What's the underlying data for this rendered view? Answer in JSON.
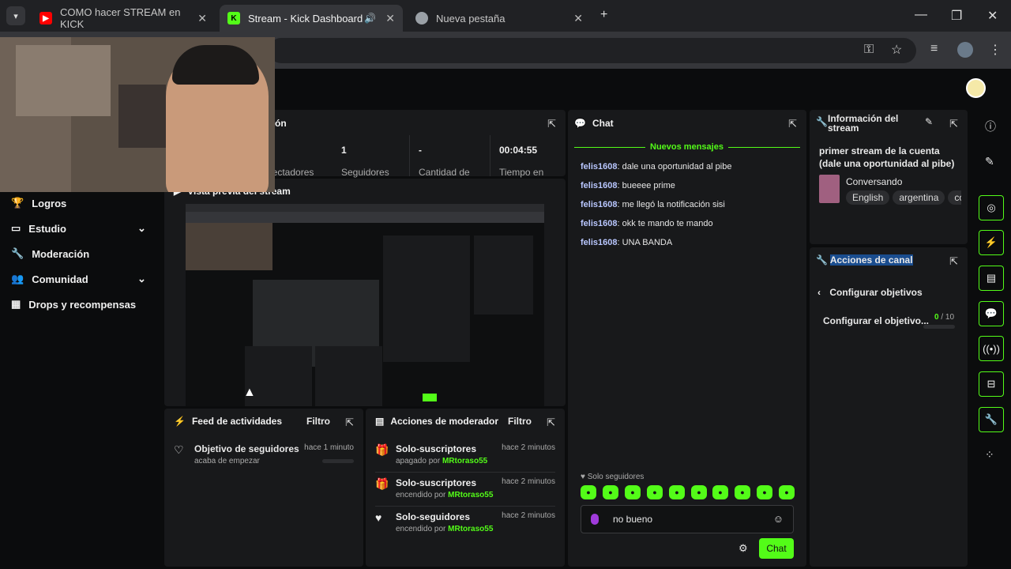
{
  "browser": {
    "tabs": [
      {
        "title": "COMO hacer STREAM en KICK"
      },
      {
        "title": "Stream - Kick Dashboard"
      },
      {
        "title": "Nueva pestaña"
      }
    ]
  },
  "sidebar": {
    "items": [
      {
        "label": "Logros",
        "icon": "trophy-icon"
      },
      {
        "label": "Estudio",
        "icon": "studio-icon"
      },
      {
        "label": "Moderación",
        "icon": "wrench-icon"
      },
      {
        "label": "Comunidad",
        "icon": "community-icon"
      },
      {
        "label": "Drops y recompensas",
        "icon": "drops-icon"
      }
    ]
  },
  "session": {
    "title_partial": "sión",
    "stats": [
      {
        "value": "",
        "label": "pectadores"
      },
      {
        "value": "1",
        "label": "Seguidores"
      },
      {
        "value": "-",
        "label": "Cantidad de"
      },
      {
        "value": "00:04:55",
        "label": "Tiempo en"
      }
    ]
  },
  "preview": {
    "title": "Vista previa del stream"
  },
  "activity": {
    "title": "Feed de actividades",
    "filter": "Filtro",
    "item": {
      "title": "Objetivo de seguidores",
      "subtitle": "acaba de empezar",
      "time": "hace 1 minuto"
    }
  },
  "mod_actions": {
    "title": "Acciones de moderador",
    "filter": "Filtro",
    "rows": [
      {
        "title": "Solo-suscriptores",
        "action": "apagado por",
        "user": "MRtoraso55",
        "time": "hace 2 minutos"
      },
      {
        "title": "Solo-suscriptores",
        "action": "encendido por",
        "user": "MRtoraso55",
        "time": "hace 2 minutos"
      },
      {
        "title": "Solo-seguidores",
        "action": "encendido por",
        "user": "MRtoraso55",
        "time": "hace 2 minutos"
      }
    ]
  },
  "chat": {
    "title": "Chat",
    "new_messages": "Nuevos mensajes",
    "messages": [
      {
        "user": "felis1608",
        "text": "dale una oportunidad al pibe"
      },
      {
        "user": "felis1608",
        "text": "bueeee prime"
      },
      {
        "user": "felis1608",
        "text": "me llegó la notificación sisi"
      },
      {
        "user": "felis1608",
        "text": "okk te mando te mando"
      },
      {
        "user": "felis1608",
        "text": "UNA BANDA"
      }
    ],
    "mode": "Solo seguidores",
    "input_value": "no bueno",
    "send_label": "Chat"
  },
  "stream_info": {
    "title": "Información del stream",
    "stream_title": "primer stream de la cuenta (dale una oportunidad al pibe)",
    "category": "Conversando",
    "tags": [
      "English",
      "argentina",
      "co"
    ]
  },
  "channel_actions": {
    "title": "Acciones de canal",
    "back_label": "Configurar objetivos",
    "goal_label": "Configurar el objetivo...",
    "goal_current": "0",
    "goal_total": "/ 10"
  },
  "colors": {
    "accent": "#53fc18",
    "panel": "#18191b",
    "bg": "#0b0c0d"
  }
}
